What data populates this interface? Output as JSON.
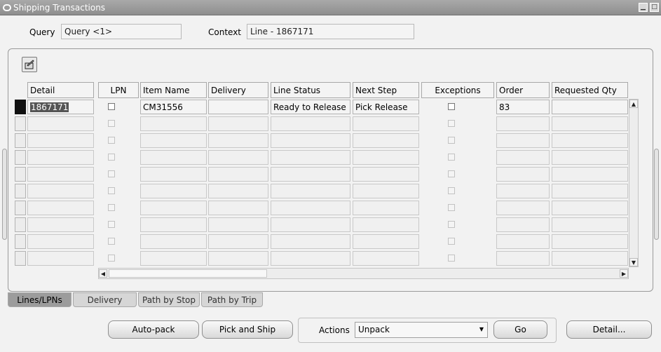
{
  "window": {
    "title": "Shipping Transactions",
    "minimize": "▁",
    "maximize": "□"
  },
  "query": {
    "label": "Query",
    "value": "Query <1>"
  },
  "context": {
    "label": "Context",
    "value": "Line - 1867171"
  },
  "table": {
    "headers": [
      "Detail",
      "LPN",
      "Item Name",
      "Delivery",
      "Line Status",
      "Next Step",
      "Exceptions",
      "Order",
      "Requested Qty"
    ],
    "first_row": {
      "detail": "1867171",
      "item_name": "CM31556",
      "line_status": "Ready to Release",
      "next_step": "Pick Release",
      "order": "83"
    }
  },
  "tabs": [
    "Lines/LPNs",
    "Delivery",
    "Path by Stop",
    "Path by Trip"
  ],
  "buttons": {
    "auto_pack": "Auto-pack",
    "pick_and_ship": "Pick and Ship",
    "actions_label": "Actions",
    "actions_value": "Unpack",
    "go": "Go",
    "detail": "Detail..."
  },
  "scroll": {
    "up": "▲",
    "down": "▼",
    "left": "◀",
    "right": "▶"
  },
  "dropdown_arrow": "▼"
}
